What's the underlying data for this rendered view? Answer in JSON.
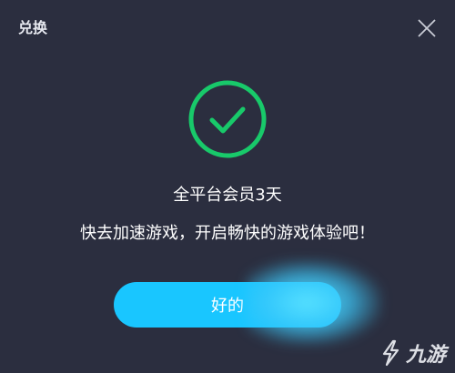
{
  "dialog": {
    "title": "兑换",
    "close_icon": "close-icon"
  },
  "result": {
    "icon": "check-circle-icon",
    "icon_color": "#18c96a",
    "headline": "全平台会员3天",
    "message": "快去加速游戏，开启畅快的游戏体验吧！"
  },
  "actions": {
    "ok_label": "好的",
    "ok_color": "#19c6ff"
  },
  "watermark": {
    "text": "九游",
    "icon": "jiuyou-logo-icon"
  }
}
